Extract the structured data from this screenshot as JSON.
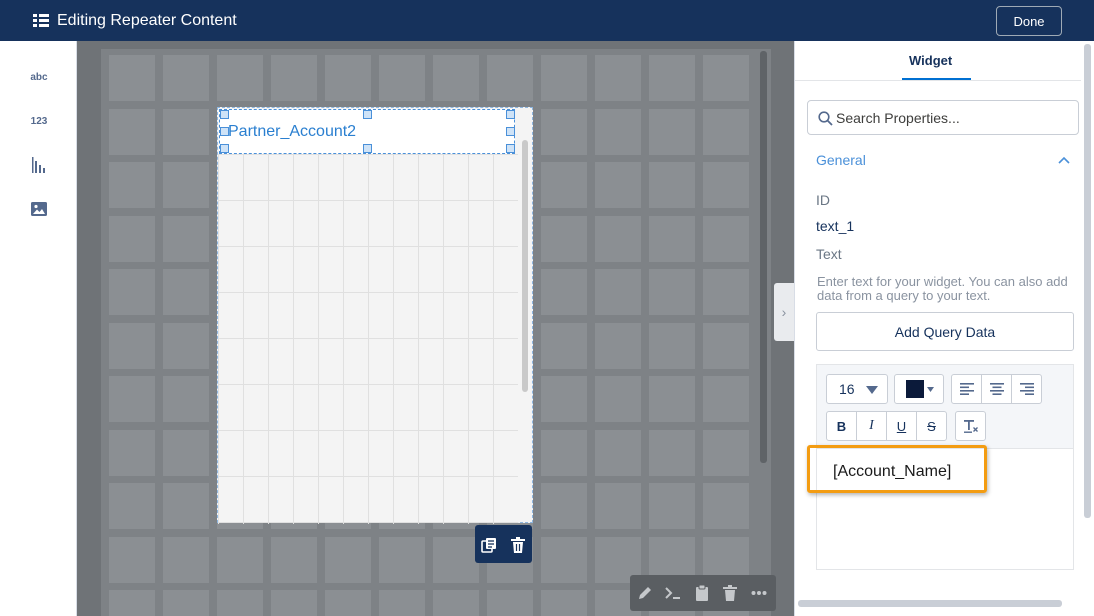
{
  "header": {
    "title": "Editing Repeater Content",
    "done_label": "Done"
  },
  "rail": {
    "items": [
      {
        "label": "abc",
        "icon": "text-icon"
      },
      {
        "label": "123",
        "icon": "number-icon"
      },
      {
        "label": "",
        "icon": "chart-icon"
      },
      {
        "label": "",
        "icon": "image-icon"
      }
    ]
  },
  "canvas": {
    "widget_text": "Partner_Account2"
  },
  "panel": {
    "tab_label": "Widget",
    "search_placeholder": "Search Properties...",
    "section_label": "General",
    "id_label": "ID",
    "id_value": "text_1",
    "text_label": "Text",
    "text_help": "Enter text for your widget. You can also add data from a query to your text.",
    "add_query_label": "Add Query Data",
    "font_size": "16",
    "text_color": "#0b1a3a",
    "editor_content": "[Account_Name]"
  },
  "colors": {
    "header_bg": "#16325c",
    "accent": "#0070d2",
    "highlight": "#f39c12"
  }
}
